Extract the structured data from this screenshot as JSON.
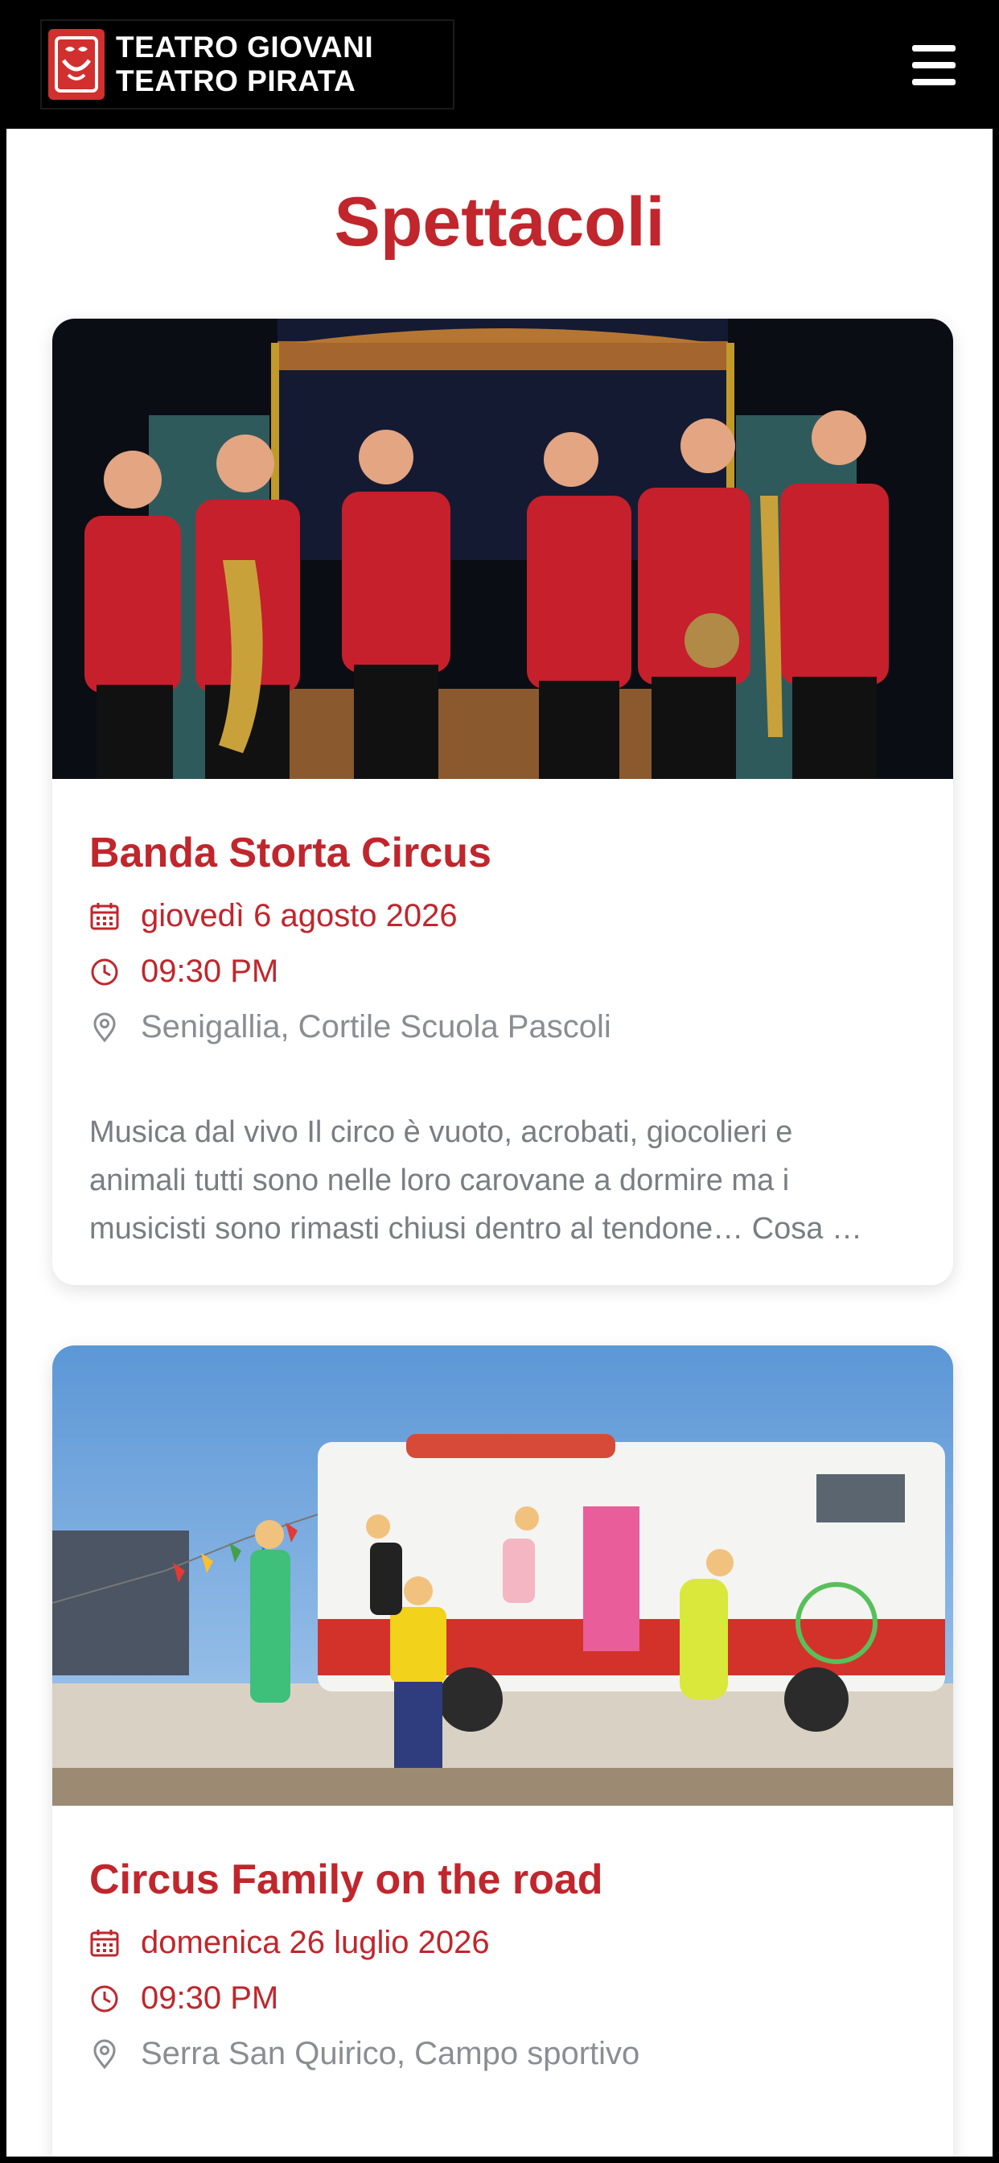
{
  "header": {
    "logo_line1": "TEATRO GIOVANI",
    "logo_line2": "TEATRO PIRATA",
    "brand_color": "#d22f2f"
  },
  "page": {
    "title": "Spettacoli",
    "accent_color": "#c0262c"
  },
  "events": [
    {
      "title": "Banda Storta Circus",
      "date": "giovedì 6 agosto 2026",
      "time": "09:30 PM",
      "location": "Senigallia, Cortile Scuola Pascoli",
      "description_lines": [
        "Musica dal vivo Il circo è vuoto, acrobati, giocolieri e",
        "animali tutti sono nelle loro carovane a dormire ma i",
        "musicisti sono rimasti chiusi dentro al tendone… Cosa …"
      ]
    },
    {
      "title": "Circus Family on the road",
      "date": "domenica 26 luglio 2026",
      "time": "09:30 PM",
      "location": "Serra San Quirico, Campo sportivo"
    }
  ]
}
